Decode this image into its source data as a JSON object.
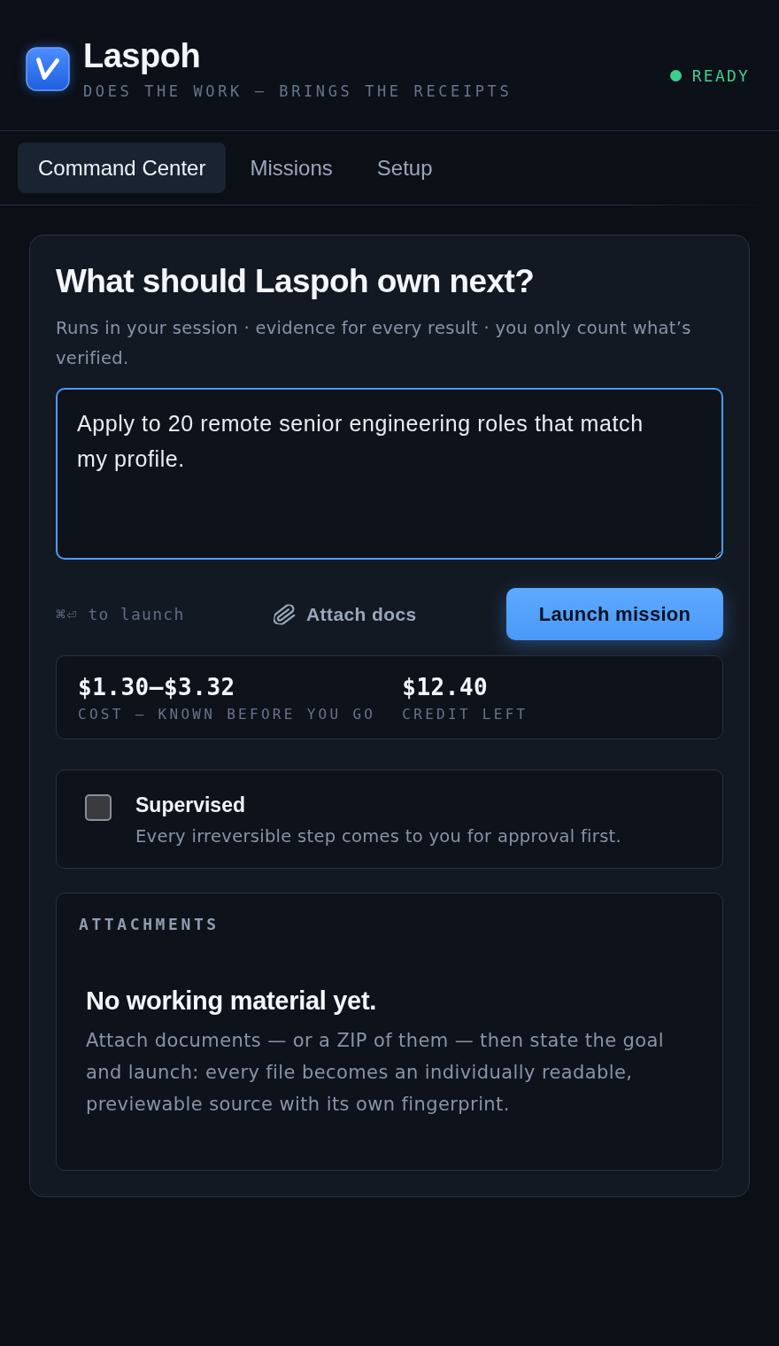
{
  "header": {
    "app_name": "Laspoh",
    "tagline": "DOES THE WORK — BRINGS THE RECEIPTS",
    "status": "READY"
  },
  "tabs": [
    {
      "label": "Command Center",
      "selected": true
    },
    {
      "label": "Missions",
      "selected": false
    },
    {
      "label": "Setup",
      "selected": false
    }
  ],
  "composer": {
    "heading": "What should Laspoh own next?",
    "subheading": "Runs in your session · evidence for every result · you only count what’s verified.",
    "goal_input": {
      "value": "Apply to 20 remote senior engineering roles that match my profile."
    },
    "shortcut_hint": "⌘⏎ to launch",
    "attach_button": "Attach docs",
    "launch_button": "Launch mission",
    "stats": [
      {
        "value": "$1.30–$3.32",
        "label": "COST — KNOWN BEFORE YOU GO"
      },
      {
        "value": "$12.40",
        "label": "CREDIT LEFT"
      }
    ],
    "supervised": {
      "label": "Supervised",
      "description": "Every irreversible step comes to you for approval first.",
      "checked": false
    },
    "attachments": {
      "title": "ATTACHMENTS",
      "empty_title": "No working material yet.",
      "empty_text": "Attach documents — or a ZIP of them — then state the goal and launch: every file becomes an individually readable, previewable source with its own fingerprint."
    }
  }
}
